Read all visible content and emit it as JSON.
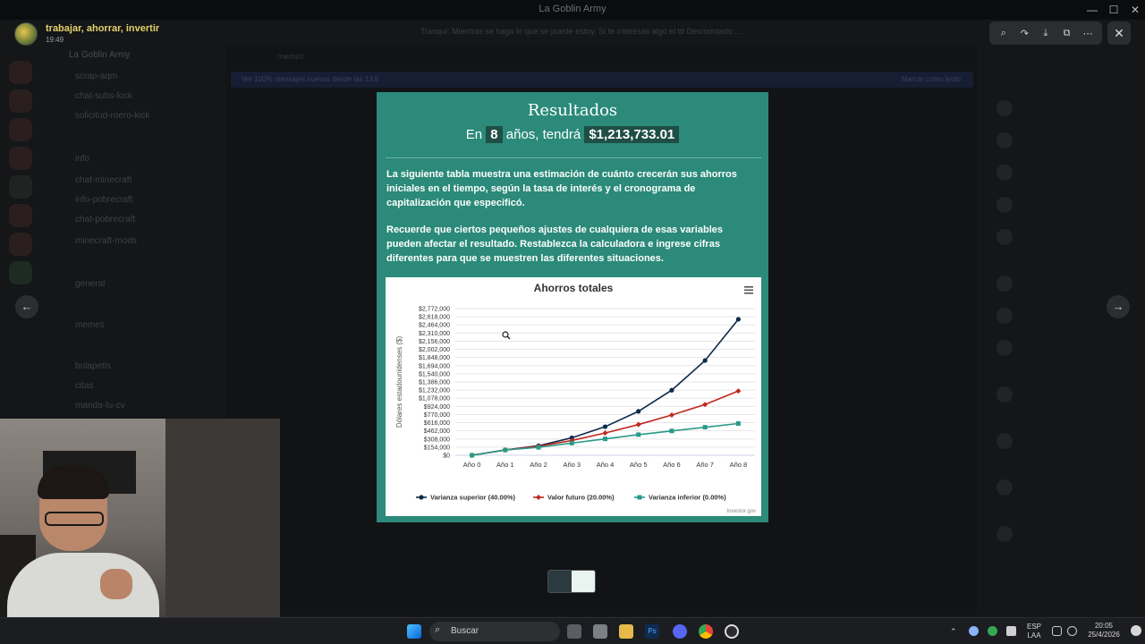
{
  "window": {
    "title": "La Goblin Army"
  },
  "viewer": {
    "author": "trabajar, ahorrar, invertir",
    "time": "19:49",
    "announcement": "Tranqui: Mientras se haga lo que se puede estoy. Si te interesas algo el ttt Desmontado ..."
  },
  "background": {
    "guild_name": "La Goblin Army",
    "channels": [
      "scrap-aqm",
      "chat-subs-kick",
      "solicitud-roero-kick",
      "info",
      "chat-minecraft",
      "info-pobrecraft",
      "chat-pobrecraft",
      "minecraft-mods",
      "general",
      "memes",
      "bolapetis",
      "citas",
      "manda-tu-cv"
    ],
    "chat_title": "memes",
    "banner_left": "Ver 100% mensajes nuevos desde las 13:5",
    "banner_right": "Marcar como leído"
  },
  "modal": {
    "title": "Resultados",
    "result_prefix": "En",
    "years": "8",
    "result_middle": "años, tendrá",
    "amount": "$1,213,733.01",
    "paragraph1": "La siguiente tabla muestra una estimación de cuánto crecerán sus ahorros iniciales en el tiempo, según la tasa de interés y el cronograma de capitalización que especificó.",
    "paragraph2": "Recuerde que ciertos pequeños ajustes de cualquiera de esas variables pueden afectar el resultado. Restablezca la calculadora e ingrese cifras diferentes para que se muestren las diferentes situaciones."
  },
  "chart_data": {
    "type": "line",
    "title": "Ahorros totales",
    "ylabel": "Dólares estadounidenses ($)",
    "xlabel": "",
    "credit": "Investor.gov",
    "categories": [
      "Año 0",
      "Año 1",
      "Año 2",
      "Año 3",
      "Año 4",
      "Año 5",
      "Año 6",
      "Año 7",
      "Año 8"
    ],
    "y_ticks": [
      "$0",
      "$154,000",
      "$308,000",
      "$462,000",
      "$616,000",
      "$770,000",
      "$924,000",
      "$1,078,000",
      "$1,232,000",
      "$1,386,000",
      "$1,540,000",
      "$1,694,000",
      "$1,848,000",
      "$2,002,000",
      "$2,156,000",
      "$2,310,000",
      "$2,464,000",
      "$2,618,000",
      "$2,772,000"
    ],
    "ylim": [
      0,
      2772000
    ],
    "grid": true,
    "legend_position": "bottom",
    "series": [
      {
        "name": "Varianza superior (40.00%)",
        "color": "#0d2a4a",
        "marker": "circle",
        "values": [
          0,
          100000,
          180000,
          330000,
          540000,
          830000,
          1230000,
          1790000,
          2570000
        ]
      },
      {
        "name": "Valor futuro (20.00%)",
        "color": "#c0281e",
        "marker": "diamond",
        "values": [
          0,
          100000,
          170000,
          280000,
          420000,
          580000,
          760000,
          960000,
          1214000
        ]
      },
      {
        "name": "Varianza inferior (0.00%)",
        "color": "#2a9a88",
        "marker": "square",
        "values": [
          0,
          100000,
          150000,
          230000,
          310000,
          390000,
          460000,
          530000,
          600000
        ]
      }
    ]
  },
  "taskbar": {
    "search_placeholder": "Buscar",
    "lang_line1": "ESP",
    "lang_line2": "LAA",
    "clock_time": "20:05",
    "clock_date": "25/4/2026"
  },
  "icons": {
    "minimize": "minimize-icon",
    "maximize": "maximize-icon",
    "close": "close-icon",
    "zoom": "zoom-icon",
    "share": "share-icon",
    "download": "download-icon",
    "open": "open-external-icon",
    "more": "more-icon",
    "prev": "arrow-left-icon",
    "next": "arrow-right-icon"
  }
}
